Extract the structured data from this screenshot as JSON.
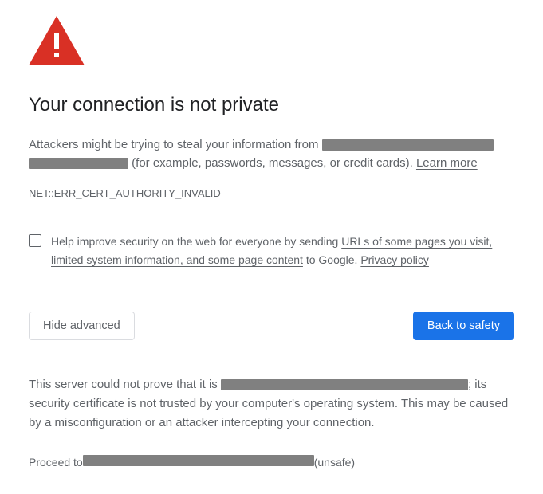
{
  "icon": "warning-triangle",
  "title": "Your connection is not private",
  "desc_before": "Attackers might be trying to steal your information from ",
  "desc_after_domain": " (for example, passwords, messages, or credit cards). ",
  "learn_more": "Learn more",
  "error_code": "NET::ERR_CERT_AUTHORITY_INVALID",
  "consent_text_before": "Help improve security on the web for everyone by sending ",
  "consent_link1": "URLs of some pages you visit, limited system information, and some page content",
  "consent_text_mid": " to Google. ",
  "consent_link2": "Privacy policy",
  "buttons": {
    "hide_advanced": "Hide advanced",
    "back_to_safety": "Back to safety"
  },
  "advanced_before": "This server could not prove that it is ",
  "advanced_after": "; its security certificate is not trusted by your computer's operating system. This may be caused by a misconfiguration or an attacker intercepting your connection.",
  "proceed_before": "Proceed to ",
  "proceed_after": " (unsafe)"
}
